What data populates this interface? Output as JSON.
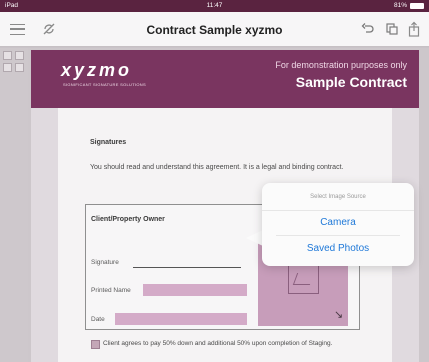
{
  "status_bar": {
    "carrier": "iPad",
    "time": "11:47",
    "battery": "81%"
  },
  "nav": {
    "title": "Contract Sample xyzmo"
  },
  "banner": {
    "logo": "xyzmo",
    "logo_tagline": "SIGNIFICANT SIGNATURE SOLUTIONS",
    "demo_notice": "For demonstration purposes only",
    "contract_title": "Sample Contract"
  },
  "document": {
    "signatures_heading": "Signatures",
    "intro_text": "You should read and understand this agreement. It is a legal and binding contract.",
    "client_label": "Client/Property Owner",
    "signature_label": "Signature",
    "printed_name_label": "Printed Name",
    "date_label": "Date",
    "agreement_text": "Client agrees to pay 50% down and additional 50% upon completion of Staging."
  },
  "image_source_popover": {
    "header": "Select Image Source",
    "options": [
      "Camera",
      "Saved Photos"
    ]
  },
  "colors": {
    "brand": "#7a3560",
    "field_highlight": "#d4abc8",
    "ios_link": "#1e78d8"
  }
}
